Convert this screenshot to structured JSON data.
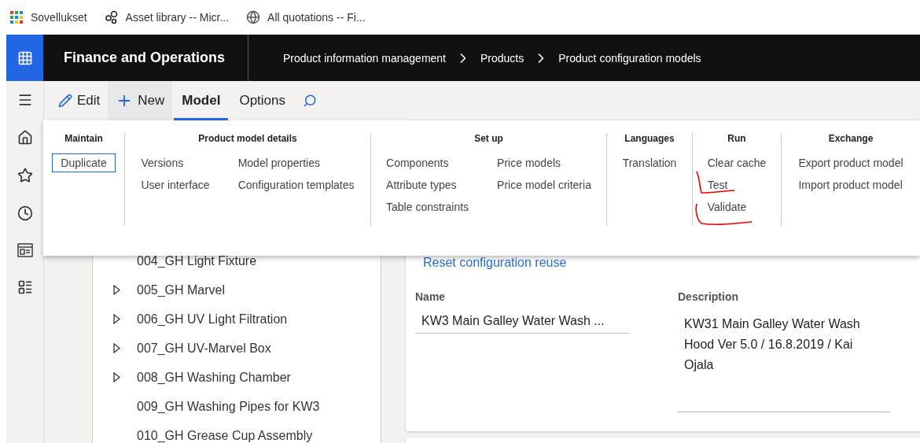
{
  "bookmarks": [
    {
      "label": "Sovellukset",
      "kind": "apps"
    },
    {
      "label": "Asset library -- Micr...",
      "kind": "network"
    },
    {
      "label": "All quotations -- Fi...",
      "kind": "globe"
    }
  ],
  "app_title": "Finance and Operations",
  "breadcrumb": [
    "Product information management",
    "Products",
    "Product configuration models"
  ],
  "action_pane": [
    {
      "label": "Edit",
      "kind": "edit"
    },
    {
      "label": "New",
      "kind": "new"
    },
    {
      "label": "Model",
      "kind": "tab",
      "selected": true
    },
    {
      "label": "Options",
      "kind": "tab",
      "selected": false
    }
  ],
  "menu_groups": [
    {
      "title": "Maintain",
      "columns": [
        [
          {
            "label": "Duplicate",
            "selected": true
          }
        ]
      ]
    },
    {
      "title": "Product model details",
      "columns": [
        [
          {
            "label": "Versions",
            "selected": false
          },
          {
            "label": "User interface",
            "selected": false
          }
        ],
        [
          {
            "label": "Model properties",
            "selected": false
          },
          {
            "label": "Configuration templates",
            "selected": false
          }
        ]
      ]
    },
    {
      "title": "Set up",
      "columns": [
        [
          {
            "label": "Components",
            "selected": false
          },
          {
            "label": "Attribute types",
            "selected": false
          },
          {
            "label": "Table constraints",
            "selected": false
          }
        ],
        [
          {
            "label": "Price models",
            "selected": false
          },
          {
            "label": "Price model criteria",
            "selected": false
          }
        ]
      ]
    },
    {
      "title": "Languages",
      "columns": [
        [
          {
            "label": "Translation",
            "selected": false
          }
        ]
      ]
    },
    {
      "title": "Run",
      "columns": [
        [
          {
            "label": "Clear cache",
            "selected": false
          },
          {
            "label": "Test",
            "selected": false
          },
          {
            "label": "Validate",
            "selected": false
          }
        ]
      ]
    },
    {
      "title": "Exchange",
      "columns": [
        [
          {
            "label": "Export product model",
            "selected": false
          },
          {
            "label": "Import product model",
            "selected": false
          }
        ]
      ]
    }
  ],
  "tree": [
    {
      "label": "004_GH Light Fixture",
      "expandable": false
    },
    {
      "label": "005_GH Marvel",
      "expandable": true
    },
    {
      "label": "006_GH UV Light Filtration",
      "expandable": true
    },
    {
      "label": "007_GH UV-Marvel Box",
      "expandable": true
    },
    {
      "label": "008_GH Washing Chamber",
      "expandable": true
    },
    {
      "label": "009_GH Washing Pipes for KW3",
      "expandable": false
    },
    {
      "label": "010_GH Grease Cup Assembly",
      "expandable": false
    }
  ],
  "details": {
    "link": "Reset configuration reuse",
    "name": {
      "label": "Name",
      "value": "KW3 Main  Galley Water Wash ..."
    },
    "description": {
      "label": "Description",
      "value": "KW31 Main Galley Water Wash Hood Ver 5.0 / 16.8.2019 / Kai Ojala"
    }
  }
}
